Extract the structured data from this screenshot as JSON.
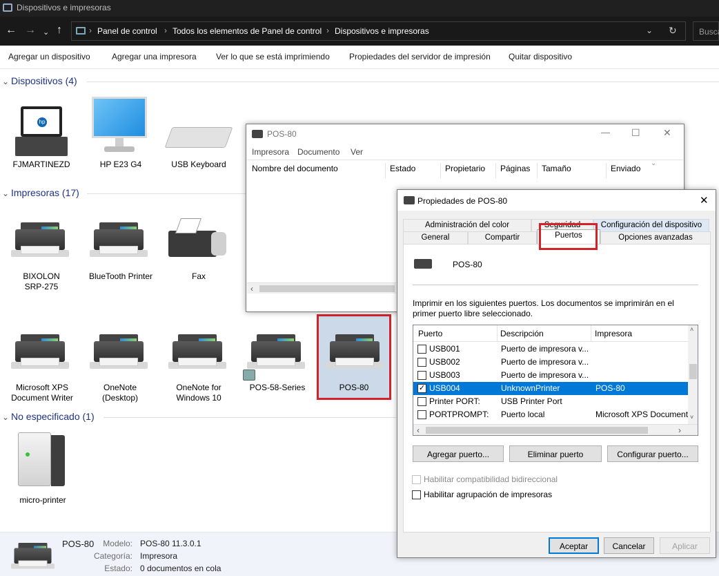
{
  "window_title": "Dispositivos e impresoras",
  "address": {
    "crumbs": [
      "Panel de control",
      "Todos los elementos de Panel de control",
      "Dispositivos e impresoras"
    ],
    "search_placeholder": "Busca"
  },
  "commands": [
    "Agregar un dispositivo",
    "Agregar una impresora",
    "Ver lo que se está imprimiendo",
    "Propiedades del servidor de impresión",
    "Quitar dispositivo"
  ],
  "groups": {
    "devices": "Dispositivos (4)",
    "printers": "Impresoras (17)",
    "unspecified": "No especificado (1)"
  },
  "devices": [
    "FJMARTINEZD",
    "HP E23 G4",
    "USB Keyboard"
  ],
  "printers": {
    "bixolon_1": "BIXOLON",
    "bixolon_2": "SRP-275",
    "bluetooth": "BlueTooth Printer",
    "fax": "Fax",
    "mxps_1": "Microsoft XPS",
    "mxps_2": "Document Writer",
    "onenote_1": "OneNote",
    "onenote_2": "(Desktop)",
    "onenote10_1": "OneNote for",
    "onenote10_2": "Windows 10",
    "pos58": "POS-58-Series",
    "pos80": "POS-80"
  },
  "unspecified": [
    "micro-printer"
  ],
  "laptop_logo": "hp",
  "status_bar": {
    "name": "POS-80",
    "model_label": "Modelo:",
    "model": "POS-80 11.3.0.1",
    "category_label": "Categoría:",
    "category": "Impresora",
    "state_label": "Estado:",
    "state": "0 documentos en cola"
  },
  "queue_window": {
    "title": "POS-80",
    "menu": [
      "Impresora",
      "Documento",
      "Ver"
    ],
    "columns": [
      "Nombre del documento",
      "Estado",
      "Propietario",
      "Páginas",
      "Tamaño",
      "Enviado"
    ],
    "min": "—",
    "max": "☐",
    "close": "✕"
  },
  "props_dialog": {
    "title": "Propiedades de POS-80",
    "tabs_top": [
      "Administración del color",
      "Seguridad",
      "Configuración del dispositivo"
    ],
    "tabs_bottom": [
      "General",
      "Compartir",
      "Puertos",
      "Opciones avanzadas"
    ],
    "printer_name": "POS-80",
    "instructions": "Imprimir en los siguientes puertos. Los documentos se imprimirán en el primer puerto libre seleccionado.",
    "columns": [
      "Puerto",
      "Descripción",
      "Impresora"
    ],
    "ports": [
      {
        "port": "USB001",
        "desc": "Puerto de impresora v...",
        "printer": "",
        "checked": false,
        "selected": false
      },
      {
        "port": "USB002",
        "desc": "Puerto de impresora v...",
        "printer": "",
        "checked": false,
        "selected": false
      },
      {
        "port": "USB003",
        "desc": "Puerto de impresora v...",
        "printer": "",
        "checked": false,
        "selected": false
      },
      {
        "port": "USB004",
        "desc": "UnknownPrinter",
        "printer": "POS-80",
        "checked": true,
        "selected": true
      },
      {
        "port": "Printer PORT:",
        "desc": "USB Printer Port",
        "printer": "",
        "checked": false,
        "selected": false
      },
      {
        "port": "PORTPROMPT:",
        "desc": "Puerto local",
        "printer": "Microsoft XPS Document",
        "checked": false,
        "selected": false
      }
    ],
    "buttons": {
      "add": "Agregar puerto...",
      "delete": "Eliminar puerto",
      "configure": "Configurar puerto..."
    },
    "bidirectional": "Habilitar compatibilidad bidireccional",
    "pooling": "Habilitar agrupación de impresoras",
    "ok": "Aceptar",
    "cancel": "Cancelar",
    "apply": "Aplicar",
    "close": "✕"
  },
  "colors": {
    "accent": "#0078d7",
    "highlight_border": "#d2232a",
    "group_header": "#1e3287",
    "dark_chrome": "#202020"
  }
}
